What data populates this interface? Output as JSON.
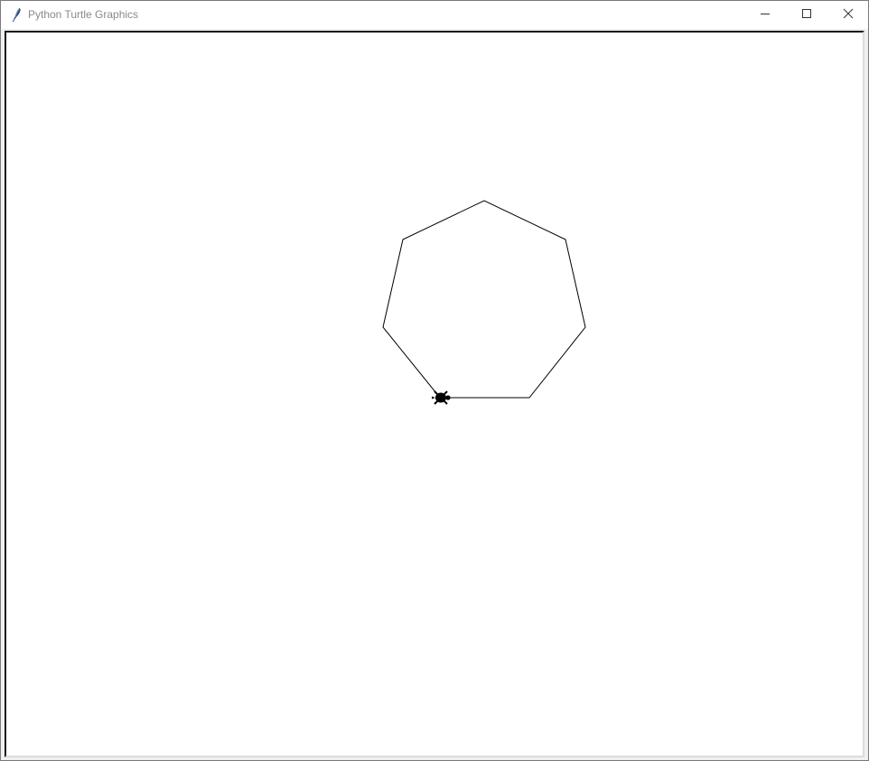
{
  "window": {
    "title": "Python Turtle Graphics",
    "icon": "feather-icon",
    "controls": {
      "minimize": "minimize-icon",
      "maximize": "maximize-icon",
      "close": "close-icon"
    }
  },
  "canvas": {
    "background": "#ffffff",
    "shape": "heptagon",
    "line_color": "#000000",
    "turtle_icon": "turtle-icon",
    "turtle_color": "#000000"
  }
}
